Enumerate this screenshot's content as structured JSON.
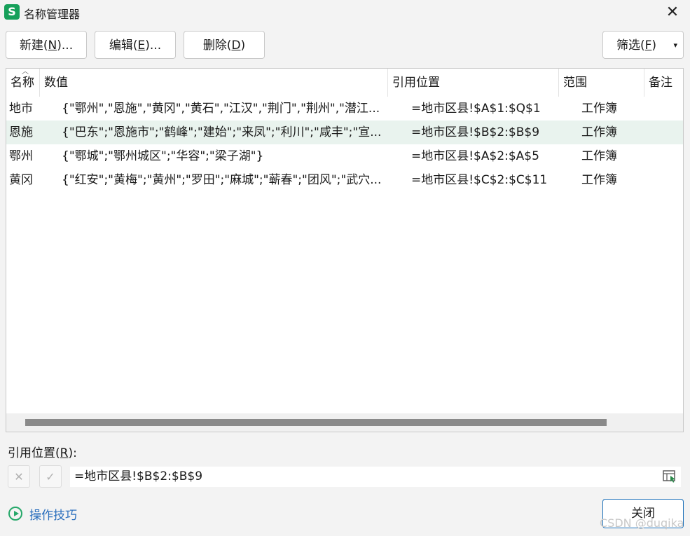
{
  "window": {
    "icon_letter": "S",
    "title": "名称管理器",
    "close_glyph": "✕"
  },
  "toolbar": {
    "new_prefix": "新建(",
    "new_key": "N",
    "new_suffix": ")...",
    "edit_prefix": "编辑(",
    "edit_key": "E",
    "edit_suffix": ")...",
    "delete_prefix": "删除(",
    "delete_key": "D",
    "delete_suffix": ")",
    "filter_prefix": "筛选(",
    "filter_key": "F",
    "filter_suffix": ")",
    "filter_arrow": "▾"
  },
  "table": {
    "columns": [
      "名称",
      "数值",
      "引用位置",
      "范围",
      "备注"
    ],
    "sort_indicator": "︿",
    "rows": [
      {
        "name": "地市",
        "value": "{\"鄂州\",\"恩施\",\"黄冈\",\"黄石\",\"江汉\",\"荆门\",\"荆州\",\"潜江...",
        "ref": "=地市区县!$A$1:$Q$1",
        "scope": "工作簿",
        "note": ""
      },
      {
        "name": "恩施",
        "value": "{\"巴东\";\"恩施市\";\"鹤峰\";\"建始\";\"来凤\";\"利川\";\"咸丰\";\"宣...",
        "ref": "=地市区县!$B$2:$B$9",
        "scope": "工作簿",
        "note": ""
      },
      {
        "name": "鄂州",
        "value": "{\"鄂城\";\"鄂州城区\";\"华容\";\"梁子湖\"}",
        "ref": "=地市区县!$A$2:$A$5",
        "scope": "工作簿",
        "note": ""
      },
      {
        "name": "黄冈",
        "value": "{\"红安\";\"黄梅\";\"黄州\";\"罗田\";\"麻城\";\"蕲春\";\"团风\";\"武穴...",
        "ref": "=地市区县!$C$2:$C$11",
        "scope": "工作簿",
        "note": ""
      }
    ],
    "selected_row": 1
  },
  "reference": {
    "label_prefix": "引用位置(",
    "label_key": "R",
    "label_suffix": "):",
    "value": "=地市区县!$B$2:$B$9",
    "cancel_glyph": "✕",
    "confirm_glyph": "✓"
  },
  "footer": {
    "tips_label": "操作技巧",
    "close_label": "关闭",
    "watermark": "CSDN @duqika"
  },
  "colors": {
    "accent": "#16a05a",
    "selected_row": "#e9f3ee",
    "link": "#2b6fbd",
    "primary_border": "#1a6fb8"
  }
}
